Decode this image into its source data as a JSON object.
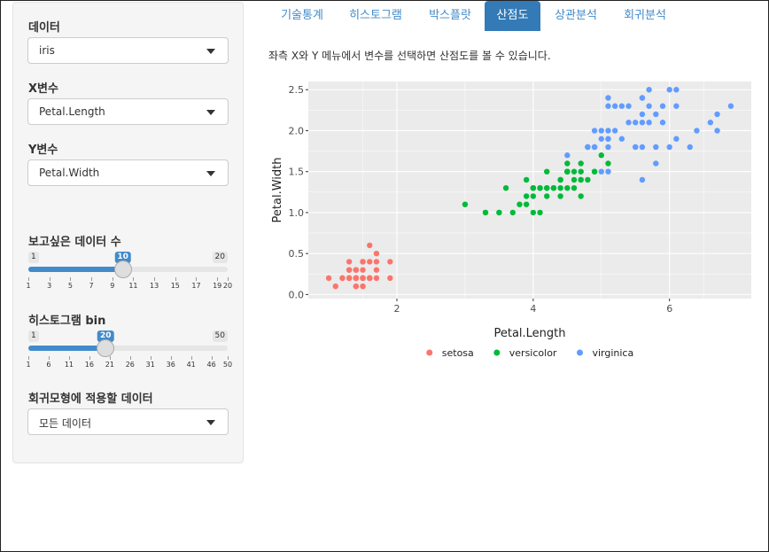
{
  "sidebar": {
    "data_label": "데이터",
    "data_value": "iris",
    "x_label": "X변수",
    "x_value": "Petal.Length",
    "y_label": "Y변수",
    "y_value": "Petal.Width",
    "n_label": "보고싶은 데이터 수",
    "n_slider": {
      "min": 1,
      "max": 20,
      "value": 10,
      "min_text": "1",
      "max_text": "20",
      "value_text": "10",
      "ticks": [
        "1",
        "3",
        "5",
        "7",
        "9",
        "11",
        "13",
        "15",
        "17",
        "19",
        "20"
      ],
      "tick_values": [
        1,
        3,
        5,
        7,
        9,
        11,
        13,
        15,
        17,
        19,
        20
      ]
    },
    "bin_label": "히스토그램 bin",
    "bin_slider": {
      "min": 1,
      "max": 50,
      "value": 20,
      "min_text": "1",
      "max_text": "50",
      "value_text": "20",
      "ticks": [
        "1",
        "6",
        "11",
        "16",
        "21",
        "26",
        "31",
        "36",
        "41",
        "46",
        "50"
      ],
      "tick_values": [
        1,
        6,
        11,
        16,
        21,
        26,
        31,
        36,
        41,
        46,
        50
      ]
    },
    "reg_label": "회귀모형에 적용할 데이터",
    "reg_value": "모든 데이터"
  },
  "tabs": [
    "기술통계",
    "히스토그램",
    "박스플랏",
    "산점도",
    "상관분석",
    "회귀분석"
  ],
  "active_tab": 3,
  "description": "좌측 X와 Y 메뉴에서 변수를 선택하면 산점도를 볼 수 있습니다.",
  "colors": {
    "accent": "#337ab7",
    "setosa": "#F8766D",
    "versicolor": "#00BA38",
    "virginica": "#619CFF",
    "panel": "#EBEBEB"
  },
  "chart_data": {
    "type": "scatter",
    "xlabel": "Petal.Length",
    "ylabel": "Petal.Width",
    "xlim": [
      0.7,
      7.2
    ],
    "ylim": [
      -0.05,
      2.6
    ],
    "xticks": [
      2,
      4,
      6
    ],
    "yticks": [
      0.0,
      0.5,
      1.0,
      1.5,
      2.0,
      2.5
    ],
    "xtick_labels": [
      "2",
      "4",
      "6"
    ],
    "ytick_labels": [
      "0.0",
      "0.5",
      "1.0",
      "1.5",
      "2.0",
      "2.5"
    ],
    "grid": true,
    "legend_position": "bottom",
    "series": [
      {
        "name": "setosa",
        "color": "#F8766D",
        "points": [
          [
            1.4,
            0.2
          ],
          [
            1.4,
            0.2
          ],
          [
            1.3,
            0.2
          ],
          [
            1.5,
            0.2
          ],
          [
            1.4,
            0.2
          ],
          [
            1.7,
            0.4
          ],
          [
            1.4,
            0.3
          ],
          [
            1.5,
            0.2
          ],
          [
            1.4,
            0.2
          ],
          [
            1.5,
            0.1
          ],
          [
            1.5,
            0.2
          ],
          [
            1.6,
            0.2
          ],
          [
            1.4,
            0.1
          ],
          [
            1.1,
            0.1
          ],
          [
            1.2,
            0.2
          ],
          [
            1.5,
            0.4
          ],
          [
            1.3,
            0.4
          ],
          [
            1.4,
            0.3
          ],
          [
            1.7,
            0.3
          ],
          [
            1.5,
            0.3
          ],
          [
            1.7,
            0.2
          ],
          [
            1.5,
            0.4
          ],
          [
            1.0,
            0.2
          ],
          [
            1.7,
            0.5
          ],
          [
            1.9,
            0.2
          ],
          [
            1.6,
            0.2
          ],
          [
            1.6,
            0.4
          ],
          [
            1.5,
            0.2
          ],
          [
            1.4,
            0.2
          ],
          [
            1.6,
            0.2
          ],
          [
            1.6,
            0.2
          ],
          [
            1.5,
            0.4
          ],
          [
            1.5,
            0.1
          ],
          [
            1.4,
            0.2
          ],
          [
            1.5,
            0.2
          ],
          [
            1.2,
            0.2
          ],
          [
            1.3,
            0.2
          ],
          [
            1.4,
            0.1
          ],
          [
            1.3,
            0.2
          ],
          [
            1.5,
            0.2
          ],
          [
            1.3,
            0.3
          ],
          [
            1.3,
            0.3
          ],
          [
            1.3,
            0.2
          ],
          [
            1.6,
            0.6
          ],
          [
            1.9,
            0.4
          ],
          [
            1.4,
            0.3
          ],
          [
            1.6,
            0.2
          ],
          [
            1.4,
            0.2
          ],
          [
            1.5,
            0.2
          ],
          [
            1.4,
            0.2
          ]
        ]
      },
      {
        "name": "versicolor",
        "color": "#00BA38",
        "points": [
          [
            4.7,
            1.4
          ],
          [
            4.5,
            1.5
          ],
          [
            4.9,
            1.5
          ],
          [
            4.0,
            1.3
          ],
          [
            4.6,
            1.5
          ],
          [
            4.5,
            1.3
          ],
          [
            4.7,
            1.6
          ],
          [
            3.3,
            1.0
          ],
          [
            4.6,
            1.3
          ],
          [
            3.9,
            1.4
          ],
          [
            3.5,
            1.0
          ],
          [
            4.2,
            1.5
          ],
          [
            4.0,
            1.0
          ],
          [
            4.7,
            1.4
          ],
          [
            3.6,
            1.3
          ],
          [
            4.4,
            1.4
          ],
          [
            4.5,
            1.5
          ],
          [
            4.1,
            1.0
          ],
          [
            4.5,
            1.5
          ],
          [
            3.9,
            1.1
          ],
          [
            4.8,
            1.8
          ],
          [
            4.0,
            1.3
          ],
          [
            4.9,
            1.5
          ],
          [
            4.7,
            1.2
          ],
          [
            4.3,
            1.3
          ],
          [
            4.4,
            1.4
          ],
          [
            4.8,
            1.4
          ],
          [
            5.0,
            1.7
          ],
          [
            4.5,
            1.5
          ],
          [
            3.5,
            1.0
          ],
          [
            3.8,
            1.1
          ],
          [
            3.7,
            1.0
          ],
          [
            3.9,
            1.2
          ],
          [
            5.1,
            1.6
          ],
          [
            4.5,
            1.5
          ],
          [
            4.5,
            1.6
          ],
          [
            4.7,
            1.5
          ],
          [
            4.4,
            1.3
          ],
          [
            4.1,
            1.3
          ],
          [
            4.0,
            1.3
          ],
          [
            4.4,
            1.2
          ],
          [
            4.6,
            1.4
          ],
          [
            4.0,
            1.2
          ],
          [
            3.3,
            1.0
          ],
          [
            4.2,
            1.3
          ],
          [
            4.2,
            1.2
          ],
          [
            4.2,
            1.3
          ],
          [
            4.3,
            1.3
          ],
          [
            3.0,
            1.1
          ],
          [
            4.1,
            1.3
          ]
        ]
      },
      {
        "name": "virginica",
        "color": "#619CFF",
        "points": [
          [
            6.0,
            2.5
          ],
          [
            5.1,
            1.9
          ],
          [
            5.9,
            2.1
          ],
          [
            5.6,
            1.8
          ],
          [
            5.8,
            2.2
          ],
          [
            6.6,
            2.1
          ],
          [
            4.5,
            1.7
          ],
          [
            6.3,
            1.8
          ],
          [
            5.8,
            1.8
          ],
          [
            6.1,
            2.5
          ],
          [
            5.1,
            2.0
          ],
          [
            5.3,
            1.9
          ],
          [
            5.5,
            2.1
          ],
          [
            5.0,
            2.0
          ],
          [
            5.1,
            2.4
          ],
          [
            5.3,
            2.3
          ],
          [
            5.5,
            1.8
          ],
          [
            6.7,
            2.2
          ],
          [
            6.9,
            2.3
          ],
          [
            5.0,
            1.5
          ],
          [
            5.7,
            2.3
          ],
          [
            4.9,
            2.0
          ],
          [
            6.7,
            2.0
          ],
          [
            4.9,
            1.8
          ],
          [
            5.7,
            2.1
          ],
          [
            6.0,
            1.8
          ],
          [
            4.8,
            1.8
          ],
          [
            4.9,
            1.8
          ],
          [
            5.6,
            2.1
          ],
          [
            5.8,
            1.6
          ],
          [
            6.1,
            1.9
          ],
          [
            6.4,
            2.0
          ],
          [
            5.6,
            2.2
          ],
          [
            5.1,
            1.5
          ],
          [
            5.6,
            1.4
          ],
          [
            6.1,
            2.3
          ],
          [
            5.6,
            2.4
          ],
          [
            5.5,
            1.8
          ],
          [
            4.8,
            1.8
          ],
          [
            5.4,
            2.1
          ],
          [
            5.6,
            2.4
          ],
          [
            5.1,
            2.3
          ],
          [
            5.1,
            1.9
          ],
          [
            5.9,
            2.3
          ],
          [
            5.7,
            2.5
          ],
          [
            5.2,
            2.3
          ],
          [
            5.0,
            1.9
          ],
          [
            5.2,
            2.0
          ],
          [
            5.4,
            2.3
          ],
          [
            5.1,
            1.8
          ]
        ]
      }
    ]
  }
}
